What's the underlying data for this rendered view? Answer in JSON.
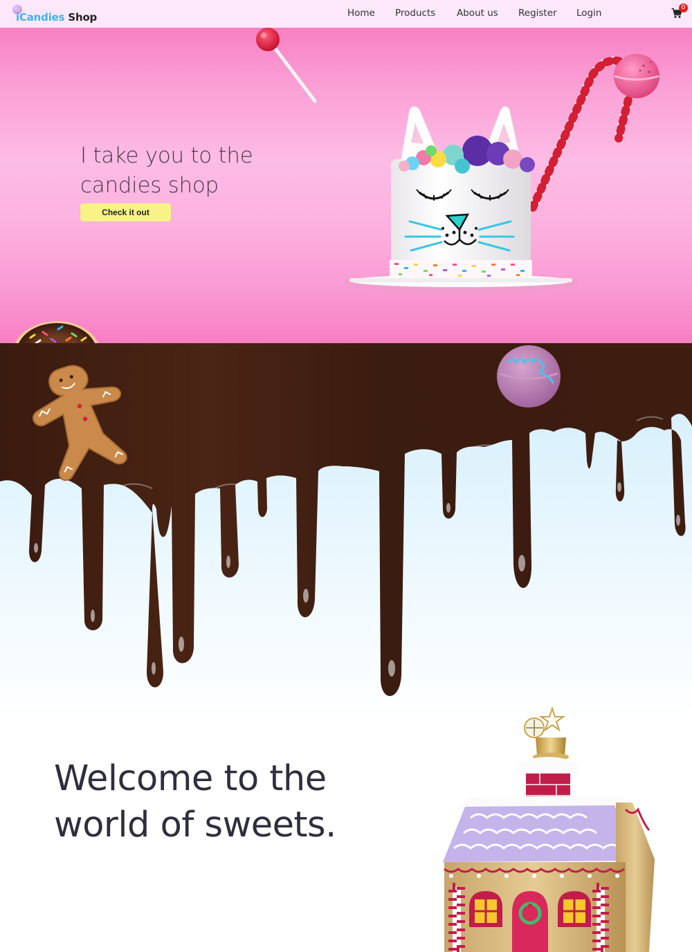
{
  "navbar": {
    "logo": {
      "prefix": "iCandies",
      "suffix": " Shop"
    },
    "links": [
      "Home",
      "Products",
      "About us",
      "Register",
      "Login"
    ],
    "cart_icon": "cart-icon",
    "cart_count": "0",
    "colors": {
      "background": "#fde8fb",
      "logo_accent": "#3fb3ee",
      "badge": "#e0231d"
    }
  },
  "hero": {
    "headline": "I take you to the candies shop",
    "cta_label": "Check it out",
    "colors": {
      "background": "#fcb2e0",
      "cta": "#f8f386"
    },
    "decorations": [
      "lollipop",
      "cat-cake",
      "candy-cane",
      "macaron",
      "donut"
    ]
  },
  "drip": {
    "colors": {
      "chocolate": "#3f1f12",
      "background": "#e4f6fd"
    },
    "decorations": [
      "gingerbread-man",
      "macaron"
    ]
  },
  "welcome": {
    "heading": "Welcome to the world of sweets.",
    "decorations": [
      "gingerbread-house-ornament"
    ]
  }
}
